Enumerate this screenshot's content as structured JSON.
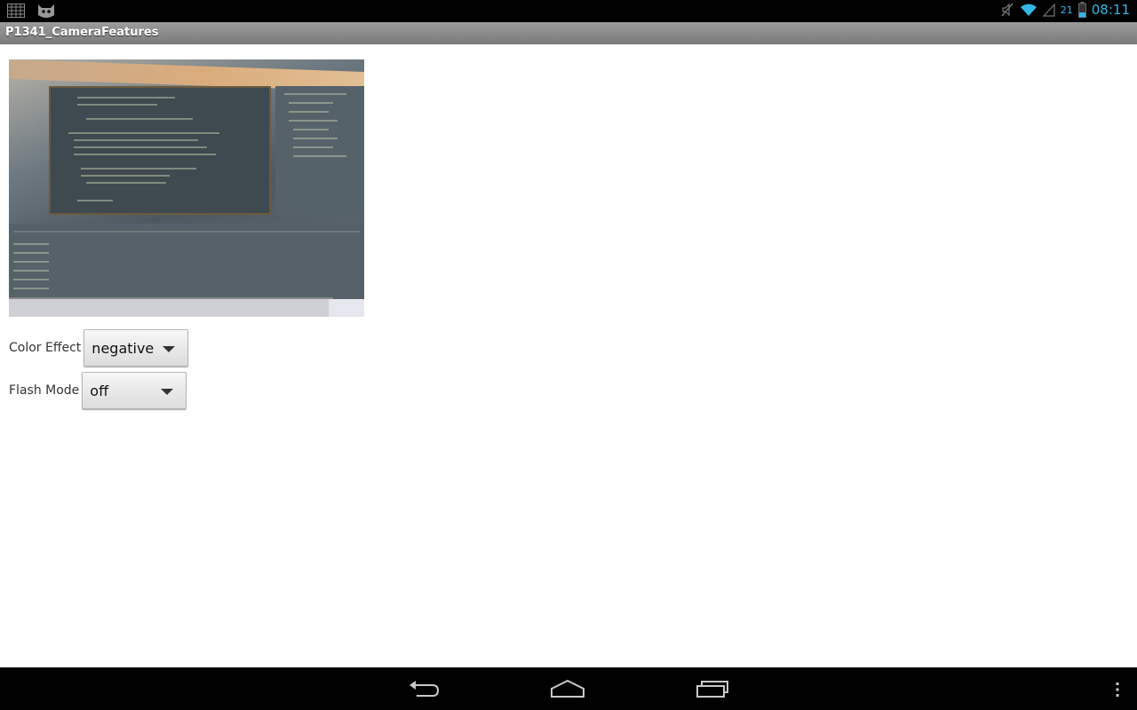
{
  "status_bar": {
    "left_icons": [
      "grid-icon",
      "cyanogen-cat-icon"
    ],
    "right_icons": [
      "mute-icon",
      "wifi-icon",
      "signal-icon",
      "battery-icon"
    ],
    "battery_level": "21",
    "time": "08:11"
  },
  "app": {
    "title": "P1341_CameraFeatures"
  },
  "camera": {
    "preview_icon": "camera-preview"
  },
  "controls": {
    "color_effect": {
      "label": "Color Effect",
      "value": "negative"
    },
    "flash_mode": {
      "label": "Flash Mode",
      "value": "off"
    }
  },
  "nav_bar": {
    "buttons": [
      "back-icon",
      "home-icon",
      "recent-apps-icon",
      "overflow-menu-icon"
    ]
  },
  "colors": {
    "accent": "#33b5e5",
    "title_bar": "#8a8a8a",
    "background": "#ffffff"
  }
}
